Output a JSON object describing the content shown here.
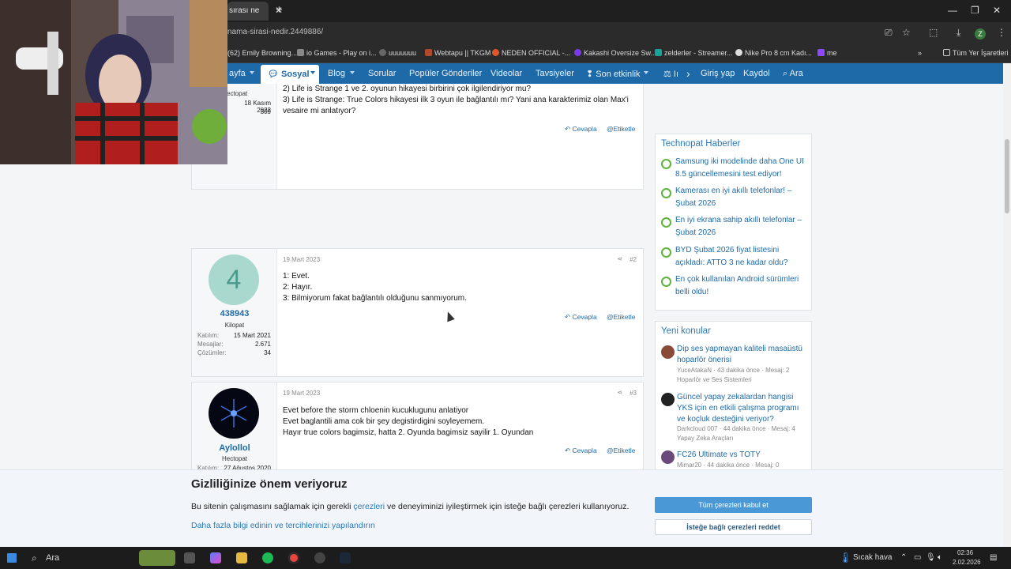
{
  "browser": {
    "tab_title": "sırası ne",
    "url": "nama-sirasi-nedir.2449886/",
    "bookmarks": [
      {
        "label": "(62) Emily Browning...",
        "color": "#c4302b"
      },
      {
        "label": "io Games - Play on i...",
        "color": "#888888"
      },
      {
        "label": "uuuuuuu",
        "color": "#666666"
      },
      {
        "label": "Webtapu || TKGM",
        "color": "#b04a2a"
      },
      {
        "label": "NEDEN OFFICIAL -...",
        "color": "#e0582a"
      },
      {
        "label": "Kakashi Oversize Sw...",
        "color": "#7c3aed"
      },
      {
        "label": "zelderler - Streamer...",
        "color": "#1aa39a"
      },
      {
        "label": "Nike Pro 8 cm Kadı...",
        "color": "#dddddd"
      },
      {
        "label": "me",
        "color": "#9146ff"
      }
    ],
    "all_bookmarks": "Tüm Yer İşaretleri",
    "profile_letter": "Z"
  },
  "nav": {
    "items": [
      "ayfa",
      "Sosyal",
      "Blog",
      "Sorular",
      "Popüler Gönderiler",
      "Videolar",
      "Tavsiyeler",
      "Son etkinlik",
      "Iı"
    ],
    "login": "Giriş yap",
    "register": "Kaydol",
    "search": "Ara"
  },
  "first_post": {
    "user_tail": "ectopat",
    "user_name_partial": "..ntans",
    "joined": "18 Kasım 2022",
    "msgs": "309",
    "lines": [
      "2) Life is Strange 1 ve 2. oyunun hikayesi birbirini çok ilgilendiriyor mu?",
      "3) Life is Strange: True Colors hikayesi ilk 3 oyun ile bağlantılı mı? Yani ana karakterimiz olan Max'i",
      "vesaire mi anlatıyor?"
    ],
    "reply": "Cevapla",
    "tag": "Etiketle"
  },
  "post2": {
    "avatar_letter": "4",
    "username": "438943",
    "user_title": "Kilopat",
    "stats": [
      {
        "label": "Katılım:",
        "value": "15 Mart 2021"
      },
      {
        "label": "Mesajlar:",
        "value": "2.671"
      },
      {
        "label": "Çözümler:",
        "value": "34"
      }
    ],
    "date": "19 Mart 2023",
    "num": "#2",
    "lines": [
      "1: Evet.",
      "2: Hayır.",
      "3: Bilmiyorum fakat bağlantılı olduğunu sanmıyorum."
    ],
    "reply": "Cevapla",
    "tag": "Etiketle"
  },
  "post3": {
    "username": "Aylollol",
    "user_title": "Hectopat",
    "stat_label": "Katılım:",
    "stat_value": "27 Ağustos 2020",
    "date": "19 Mart 2023",
    "num": "#3",
    "lines": [
      "Evet before the storm chloenin kucuklugunu anlatiyor",
      "Evet baglantili ama cok bir şey degistirdigini soyleyemem.",
      "Hayır true colors bagimsiz, hatta 2. Oyunda bagimsiz sayilir 1. Oyundan"
    ],
    "reply": "Cevapla",
    "tag": "Etiketle"
  },
  "sidebar": {
    "news_title": "Technopat Haberler",
    "news": [
      "Samsung iki modelinde daha One UI 8.5 güncellemesini test ediyor!",
      "Kamerası en iyi akıllı telefonlar! – Şubat 2026",
      "En iyi ekrana sahip akıllı telefonlar – Şubat 2026",
      "BYD Şubat 2026 fiyat listesini açıkladı: ATTO 3 ne kadar oldu?",
      "En çok kullanılan Android sürümleri belli oldu!"
    ],
    "new_topics_title": "Yeni konular",
    "topics": [
      {
        "title": "Dip ses yapmayan kaliteli masaüstü hoparlör önerisi",
        "meta": "YuceAtakaN · 43 dakika önce · Mesaj: 2",
        "forum": "Hoparlör ve Ses Sistemleri",
        "color": "#8a4a3a"
      },
      {
        "title": "Güncel yapay zekalardan hangisi YKS için en etkili çalışma programı ve koçluk desteğini veriyor?",
        "meta": "Darkcloud 007 · 44 dakika önce · Mesaj: 4",
        "forum": "Yapay Zeka Araçları",
        "color": "#222222"
      },
      {
        "title": "FC26 Ultimate vs TOTY",
        "meta": "Mimar20 · 44 dakika önce · Mesaj: 0",
        "forum": "",
        "color": "#6a4a7a"
      }
    ]
  },
  "cookie": {
    "title": "Gizliliğinize önem veriyoruz",
    "text_before": "Bu sitenin çalışmasını sağlamak için gerekli ",
    "link": "çerezleri",
    "text_after": " ve deneyiminizi iyileştirmek için isteğe bağlı çerezleri kullanıyoruz.",
    "more": "Daha fazla bilgi edinin ve tercihlerinizi yapılandırın",
    "accept": "Tüm çerezleri kabul et",
    "reject": "İsteğe bağlı çerezleri reddet"
  },
  "taskbar": {
    "search": "Ara",
    "weather": "Sıcak hava",
    "time": "02:36",
    "date": "2.02.2026"
  }
}
